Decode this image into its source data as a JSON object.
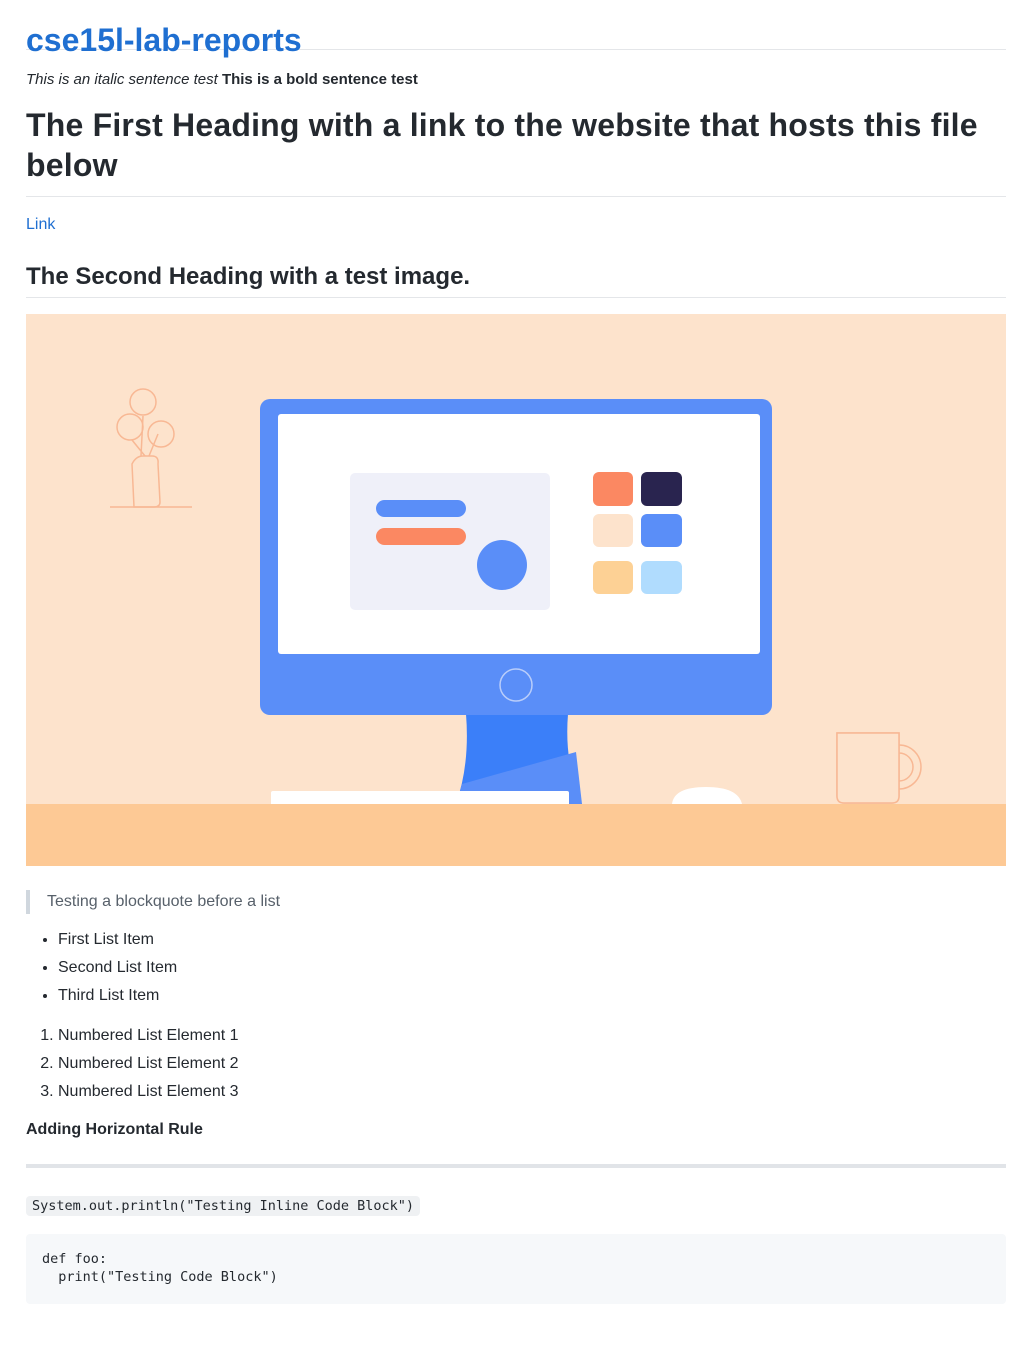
{
  "header": {
    "site_title": "cse15l-lab-reports"
  },
  "intro": {
    "italic_text": "This is an italic sentence test",
    "bold_text": "This is a bold sentence test"
  },
  "heading_one": "The First Heading with a link to the website that hosts this file below",
  "link_label": "Link",
  "heading_two": "The Second Heading with a test image.",
  "illustration": {
    "icon": "desktop-computer-illustration",
    "colors": {
      "background": "#fde3cc",
      "desk": "#fdc995",
      "monitor": "#5a8ef8",
      "stand": "#3b7ff9",
      "screen": "#ffffff",
      "panel": "#eff0f9",
      "orange": "#fb8862",
      "navy": "#29244f",
      "peach": "#fde3cc",
      "yellow": "#fdd195",
      "light_blue": "#b0dcfe",
      "outline": "#f8b894"
    }
  },
  "blockquote": "Testing a blockquote before a list",
  "bullet_list": [
    "First List Item",
    "Second List Item",
    "Third List Item"
  ],
  "numbered_list": [
    "Numbered List Element 1",
    "Numbered List Element 2",
    "Numbered List Element 3"
  ],
  "rule_caption": "Adding Horizontal Rule",
  "inline_code": "System.out.println(\"Testing Inline Code Block\")",
  "code_block": "def foo:\n  print(\"Testing Code Block\")"
}
